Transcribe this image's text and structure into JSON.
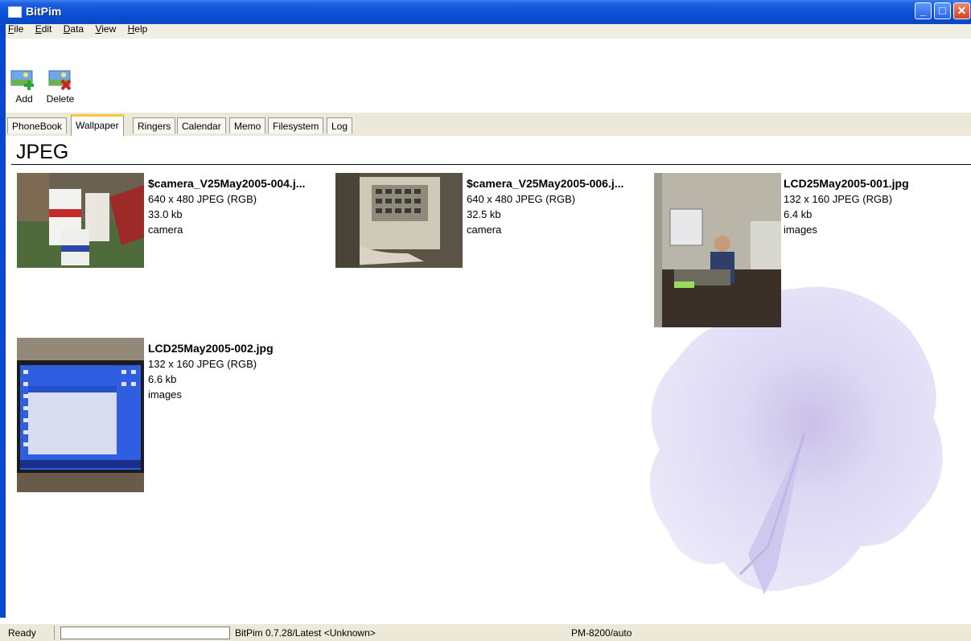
{
  "window": {
    "title": "BitPim"
  },
  "menu": {
    "items": [
      {
        "label": "File",
        "accel": "F"
      },
      {
        "label": "Edit",
        "accel": "E"
      },
      {
        "label": "Data",
        "accel": "D"
      },
      {
        "label": "View",
        "accel": "V"
      },
      {
        "label": "Help",
        "accel": "H"
      }
    ]
  },
  "toolbar": {
    "add_label": "Add",
    "delete_label": "Delete"
  },
  "tabs": [
    "PhoneBook",
    "Wallpaper",
    "Ringers",
    "Calendar",
    "Memo",
    "Filesystem",
    "Log"
  ],
  "active_tab": "Wallpaper",
  "group": {
    "title": "JPEG"
  },
  "items": [
    {
      "name": "$camera_V25May2005-004.j...",
      "size": "640 x 480 JPEG (RGB)",
      "filesize": "33.0 kb",
      "origin": "camera"
    },
    {
      "name": "$camera_V25May2005-006.j...",
      "size": "640 x 480 JPEG (RGB)",
      "filesize": "32.5 kb",
      "origin": "camera"
    },
    {
      "name": "LCD25May2005-001.jpg",
      "size": "132 x 160 JPEG (RGB)",
      "filesize": "6.4 kb",
      "origin": "images"
    },
    {
      "name": "LCD25May2005-002.jpg",
      "size": "132 x 160 JPEG (RGB)",
      "filesize": "6.6 kb",
      "origin": "images"
    }
  ],
  "status": {
    "ready": "Ready",
    "version": "BitPim 0.7.28/Latest <Unknown>",
    "phone": "PM-8200/auto"
  },
  "colors": {
    "titlebar": "#0a4fd6",
    "tab_highlight": "#ffc83c",
    "watermark": "#d6d0f2"
  }
}
